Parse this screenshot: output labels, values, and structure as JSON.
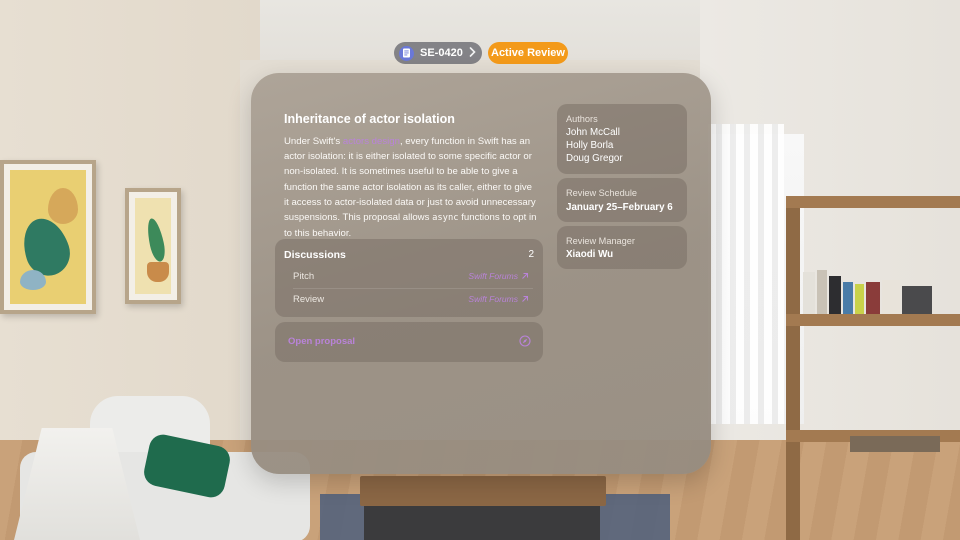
{
  "proposal": {
    "id": "SE-0420",
    "status": "Active Review",
    "title": "Inheritance of actor isolation",
    "description": {
      "before_link": "Under Swift's ",
      "link": "actors design",
      "after_link": ", every function in Swift has an actor isolation: it is either isolated to some specific actor or non-isolated. It is sometimes useful to be able to give a function the same actor isolation as its caller, either to give it access to actor-isolated data or just to avoid unnecessary suspensions. This proposal allows ",
      "code": "async",
      "after_code": " functions to opt in to this behavior."
    }
  },
  "discussions": {
    "title": "Discussions",
    "count": "2",
    "items": [
      {
        "label": "Pitch",
        "link": "Swift Forums"
      },
      {
        "label": "Review",
        "link": "Swift Forums"
      }
    ]
  },
  "open_proposal": {
    "label": "Open proposal"
  },
  "authors": {
    "label": "Authors",
    "names": [
      "John McCall",
      "Holly Borla",
      "Doug Gregor"
    ]
  },
  "review_schedule": {
    "label": "Review Schedule",
    "value": "January 25–February 6"
  },
  "review_manager": {
    "label": "Review Manager",
    "value": "Xiaodi Wu"
  },
  "colors": {
    "status": "#f39a1a",
    "link": "#b983d9",
    "id_icon": "#6a78d8"
  },
  "icons": {
    "id": "document-icon",
    "chevron": "chevron-right-icon",
    "external": "arrow-up-right-icon",
    "compass": "compass-icon"
  }
}
